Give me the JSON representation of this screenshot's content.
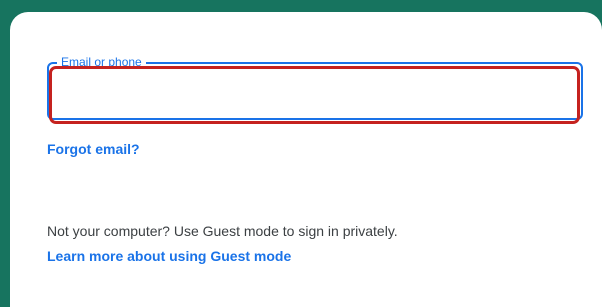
{
  "colors": {
    "background": "#17745f",
    "card": "#ffffff",
    "primary": "#1a73e8",
    "error": "#c5221f",
    "text": "#3c4043"
  },
  "email_field": {
    "label": "Email or phone",
    "value": ""
  },
  "links": {
    "forgot_email": "Forgot email?",
    "learn_more": "Learn more about using Guest mode"
  },
  "guest": {
    "text": "Not your computer? Use Guest mode to sign in privately."
  }
}
